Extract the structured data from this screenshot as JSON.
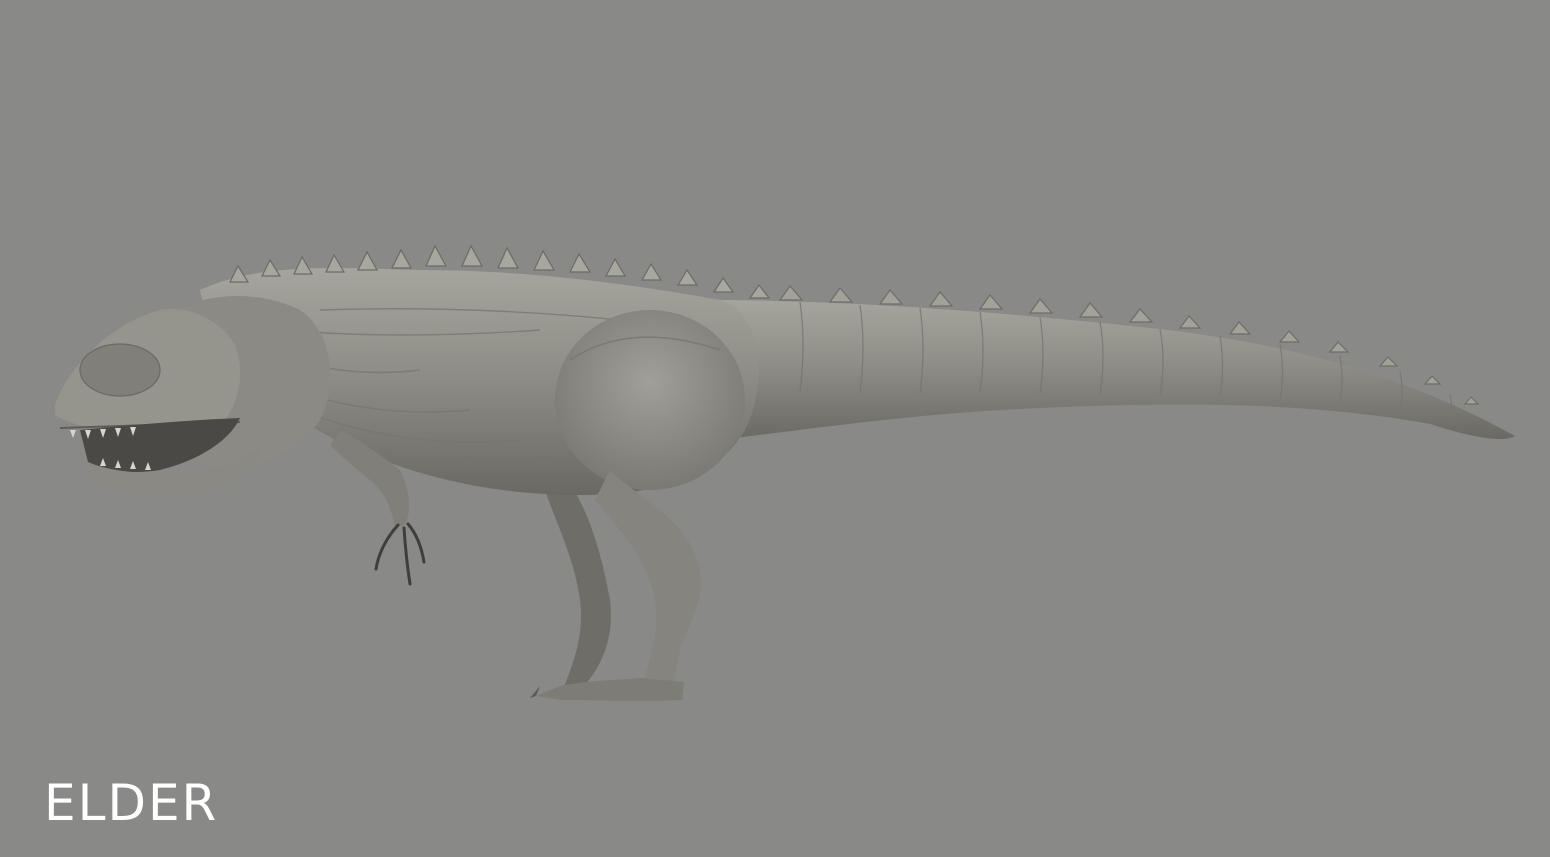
{
  "background_color": "#898988",
  "sculpt": {
    "subject": "theropod-dinosaur-sculpt",
    "base_color": "#8e8d86",
    "highlight_color": "#a9a8a0",
    "shadow_color": "#55544f"
  },
  "caption": {
    "text": "ELDER",
    "color": "#ffffff"
  }
}
